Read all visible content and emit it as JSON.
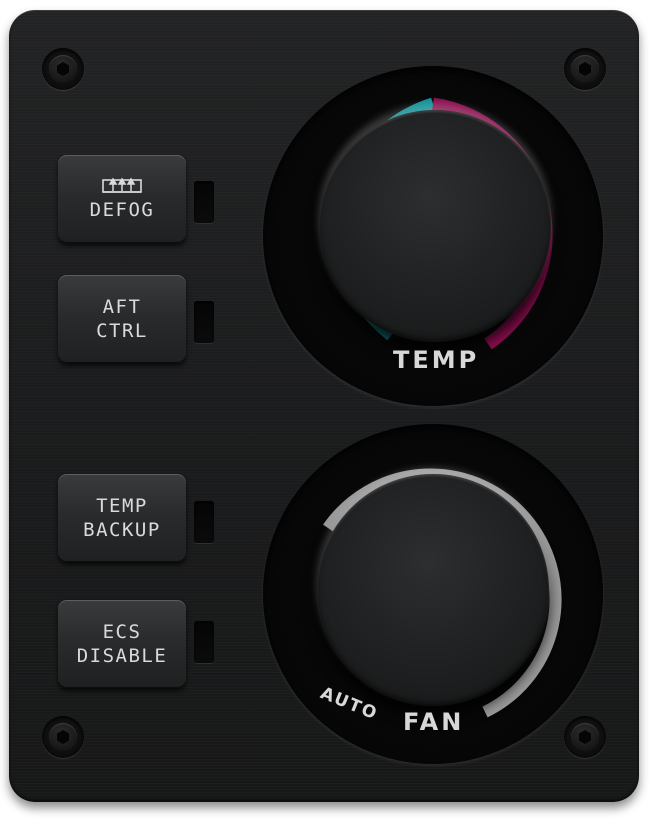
{
  "panel": {
    "buttons": [
      {
        "id": "defog",
        "icon": "defog-icon",
        "lines": [
          "DEFOG"
        ]
      },
      {
        "id": "aft-ctrl",
        "lines": [
          "AFT",
          "CTRL"
        ]
      },
      {
        "id": "temp-backup",
        "lines": [
          "TEMP",
          "BACKUP"
        ]
      },
      {
        "id": "ecs-disable",
        "lines": [
          "ECS",
          "DISABLE"
        ]
      }
    ],
    "temp_knob": {
      "label": "TEMP",
      "cold_color": "#0f8f96",
      "hot_color": "#8a0d4e"
    },
    "fan_knob": {
      "label": "FAN",
      "auto_label": "AUTO",
      "arc_color": "#9a9a9a"
    },
    "screw_icon": "hex-screw-icon"
  }
}
